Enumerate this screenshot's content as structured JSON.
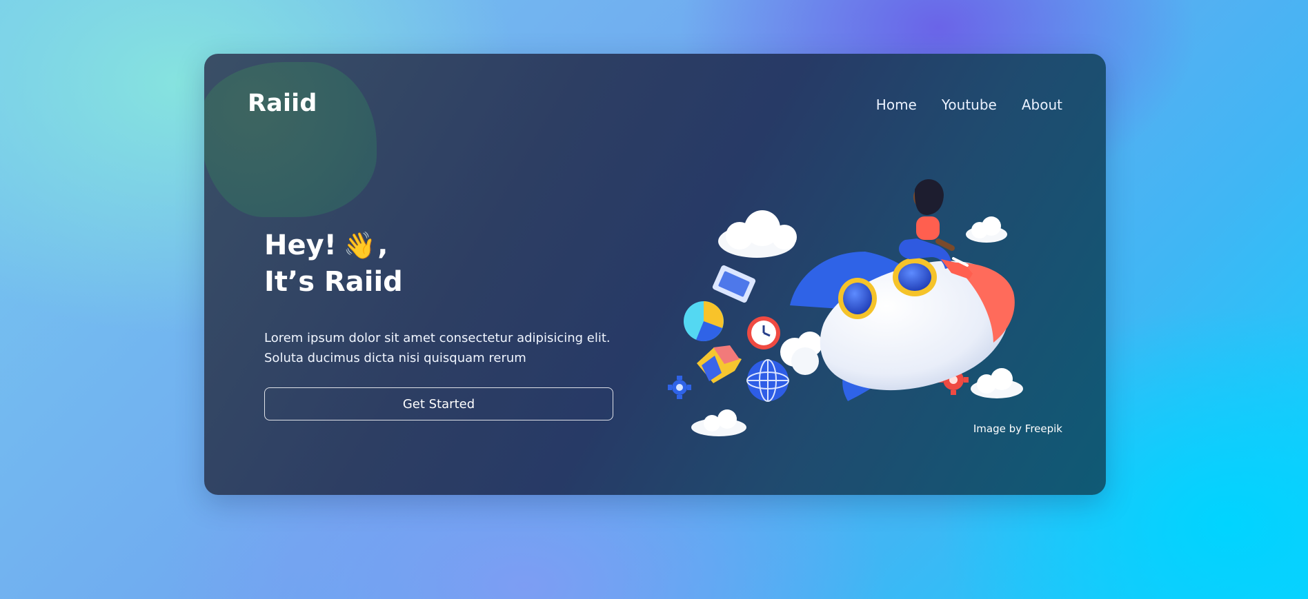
{
  "brand": {
    "name": "Raiid"
  },
  "nav": {
    "items": [
      {
        "label": "Home"
      },
      {
        "label": "Youtube"
      },
      {
        "label": "About"
      }
    ]
  },
  "hero": {
    "line1_prefix": "Hey!",
    "line1_suffix": ",",
    "wave_glyph": "👋",
    "line2": "It’s Raiid",
    "description_line1": "Lorem ipsum dolor sit amet consectetur adipisicing elit.",
    "description_line2": "Soluta ducimus dicta nisi quisquam rerum",
    "cta_label": "Get Started"
  },
  "illustration": {
    "icon": "rocket-illustration"
  },
  "credit": {
    "text": "Image by Freepik"
  },
  "colors": {
    "card_start": "#3a4f66",
    "card_end": "#0f5a75",
    "accent_blue": "#2f63e7",
    "accent_red": "#ff5f4f",
    "accent_yellow": "#f8c32a"
  }
}
